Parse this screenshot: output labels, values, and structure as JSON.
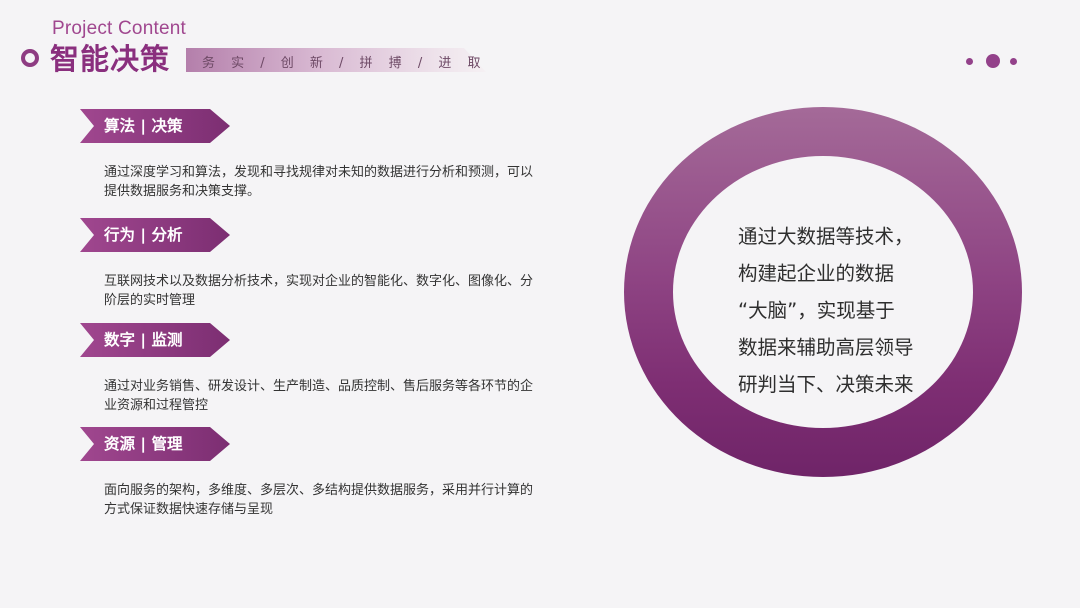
{
  "header": {
    "subtitle_en": "Project Content",
    "title_cn": "智能决策",
    "motto": "务 实 / 创 新 / 拼 搏 / 进 取"
  },
  "colors": {
    "accent": "#8e3c82",
    "accent_light": "#b47fab",
    "background": "#f5f4f6"
  },
  "items": [
    {
      "tag": "算法 | 决策",
      "desc": "通过深度学习和算法，发现和寻找规律对未知的数据进行分析和预测，可以提供数据服务和决策支撑。"
    },
    {
      "tag": "行为 | 分析",
      "desc": "互联网技术以及数据分析技术，实现对企业的智能化、数字化、图像化、分阶层的实时管理"
    },
    {
      "tag": "数字 | 监测",
      "desc": "通过对业务销售、研发设计、生产制造、品质控制、售后服务等各环节的企业资源和过程管控"
    },
    {
      "tag": "资源 | 管理",
      "desc": "面向服务的架构，多维度、多层次、多结构提供数据服务，采用并行计算的方式保证数据快速存储与呈现"
    }
  ],
  "circle": {
    "lines": [
      "通过大数据等技术，",
      "构建起企业的数据",
      "“大脑”，实现基于",
      "数据来辅助高层领导",
      "研判当下、决策未来"
    ]
  }
}
